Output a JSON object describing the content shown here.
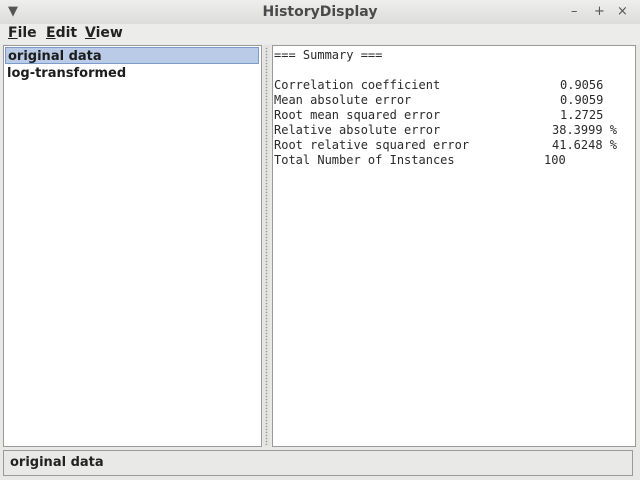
{
  "window": {
    "title": "HistoryDisplay",
    "menu_glyph": "▼",
    "minimize_glyph": "–",
    "maximize_glyph": "+",
    "close_glyph": "×"
  },
  "menubar": {
    "file": {
      "mnemonic": "F",
      "rest": "ile"
    },
    "edit": {
      "mnemonic": "E",
      "rest": "dit"
    },
    "view": {
      "mnemonic": "V",
      "rest": "iew"
    }
  },
  "history": {
    "items": [
      {
        "label": "original data",
        "selected": true
      },
      {
        "label": "log-transformed",
        "selected": false
      }
    ]
  },
  "output": {
    "header": "=== Summary ===",
    "rows": [
      {
        "label": "Correlation coefficient",
        "value": "0.9056"
      },
      {
        "label": "Mean absolute error",
        "value": "0.9059"
      },
      {
        "label": "Root mean squared error",
        "value": "1.2725"
      },
      {
        "label": "Relative absolute error",
        "value": "38.3999 %"
      },
      {
        "label": "Root relative squared error",
        "value": "41.6248 %"
      },
      {
        "label": "Total Number of Instances",
        "value": "100"
      }
    ]
  },
  "status": {
    "text": "original data"
  }
}
